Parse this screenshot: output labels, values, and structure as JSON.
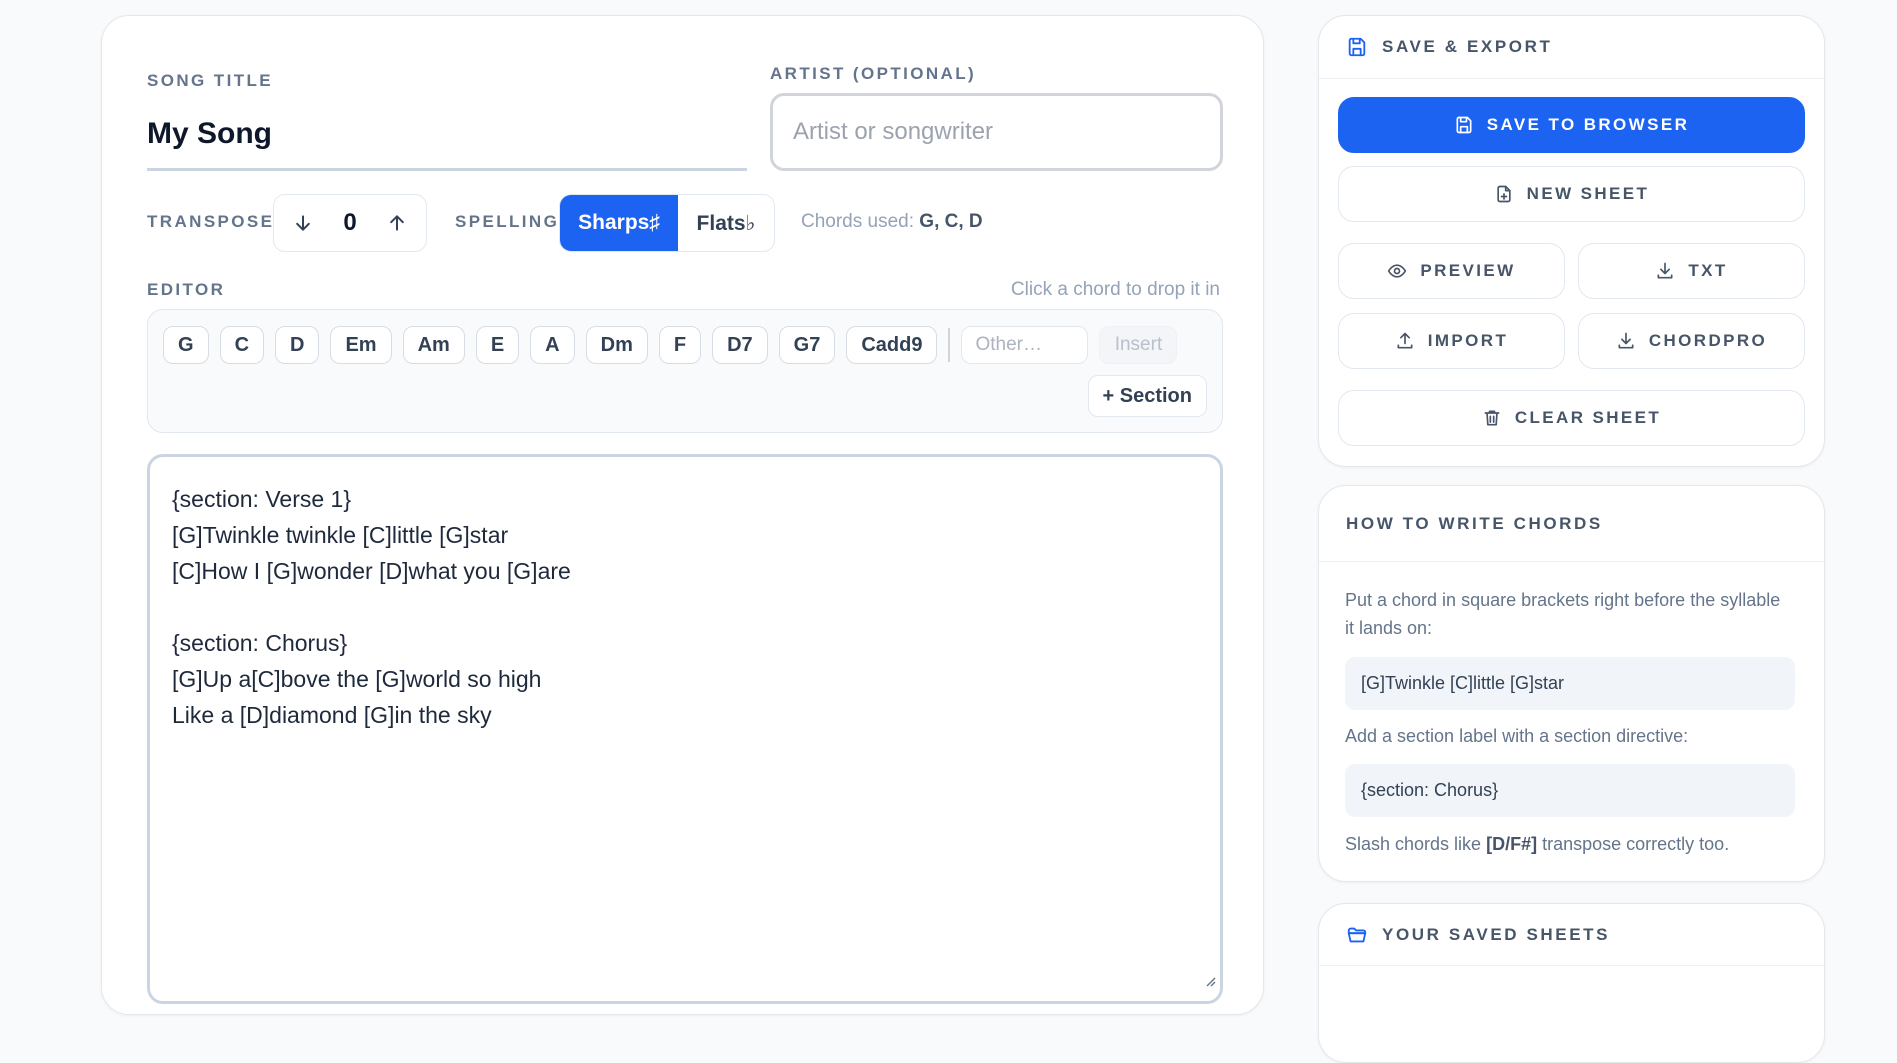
{
  "song_title": {
    "label": "SONG TITLE",
    "value": "My Song"
  },
  "artist": {
    "label": "ARTIST (OPTIONAL)",
    "placeholder": "Artist or songwriter",
    "value": ""
  },
  "transpose": {
    "label": "TRANSPOSE",
    "value": "0"
  },
  "spelling": {
    "label": "SPELLING",
    "sharps_label": "Sharps♯",
    "flats_label": "Flats♭",
    "selected": "Sharps♯"
  },
  "chords_used": {
    "label": "Chords used:",
    "value": "G, C, D"
  },
  "editor": {
    "label": "EDITOR",
    "hint": "Click a chord to drop it in",
    "chips": [
      "G",
      "C",
      "D",
      "Em",
      "Am",
      "E",
      "A",
      "Dm",
      "F",
      "D7",
      "G7",
      "Cadd9"
    ],
    "other_placeholder": "Other…",
    "insert_label": "Insert",
    "section_label": "+ Section",
    "lines": [
      "{section: Verse 1}",
      "[G]Twinkle twinkle [C]little [G]star",
      "[C]How I [G]wonder [D]what you [G]are",
      "",
      "{section: Chorus}",
      "[G]Up a[C]bove the [G]world so high",
      "Like a [D]diamond [G]in the sky"
    ]
  },
  "save_export": {
    "title": "SAVE & EXPORT",
    "save_browser": "SAVE TO BROWSER",
    "new_sheet": "NEW SHEET",
    "preview": "PREVIEW",
    "txt": "TXT",
    "import": "IMPORT",
    "chordpro": "CHORDPRO",
    "clear_sheet": "CLEAR SHEET"
  },
  "how_to": {
    "title": "HOW TO WRITE CHORDS",
    "text1": "Put a chord in square brackets right before the syllable it lands on:",
    "example1": "[G]Twinkle [C]little [G]star",
    "text2": "Add a section label with a section directive:",
    "example2": "{section: Chorus}",
    "text3_pre": "Slash chords like",
    "text3_code": "[D/F#]",
    "text3_post": "transpose correctly too."
  },
  "saved_sheets": {
    "title": "YOUR SAVED SHEETS"
  },
  "colors": {
    "accent": "#1d63f2",
    "border": "#e2e8f0",
    "muted": "#64748b"
  },
  "icons": [
    "arrow-down-icon",
    "arrow-up-icon",
    "save-icon",
    "new-file-icon",
    "eye-icon",
    "download-icon",
    "upload-icon",
    "trash-icon",
    "folder-icon",
    "resize-grip-icon"
  ]
}
